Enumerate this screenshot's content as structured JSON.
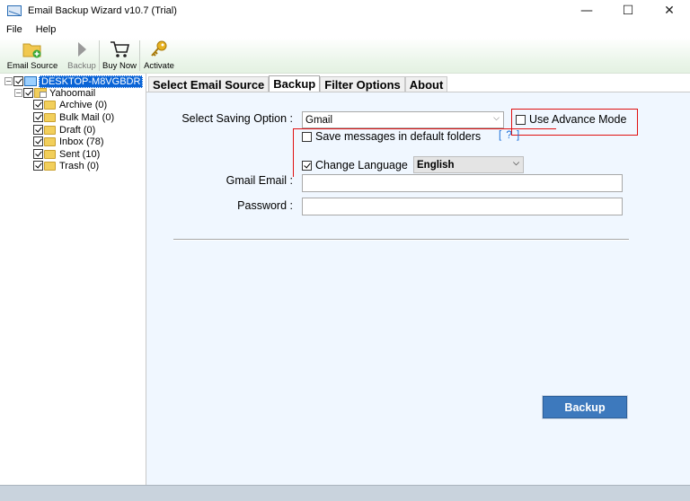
{
  "window": {
    "title": "Email Backup Wizard v10.7 (Trial)",
    "controls": {
      "minimize": "—",
      "maximize": "☐",
      "close": "✕"
    }
  },
  "menu": {
    "items": [
      "File",
      "Help"
    ]
  },
  "toolbar": {
    "email_source": "Email Source",
    "backup": "Backup",
    "buy_now": "Buy Now",
    "activate": "Activate"
  },
  "tree": {
    "root": "DESKTOP-M8VGBDR",
    "account": "Yahoomail",
    "folders": [
      "Archive (0)",
      "Bulk Mail (0)",
      "Draft (0)",
      "Inbox (78)",
      "Sent (10)",
      "Trash (0)"
    ]
  },
  "tabs": [
    "Select Email Source",
    "Backup",
    "Filter Options",
    "About"
  ],
  "backup": {
    "saving_option_label": "Select Saving Option :",
    "saving_option_value": "Gmail",
    "advance_mode_label": "Use Advance Mode",
    "save_default_label": "Save messages in default folders",
    "help_link": "[ ? ]",
    "change_language_label": "Change Language",
    "language_value": "English",
    "gmail_email_label": "Gmail Email :",
    "gmail_email_value": "",
    "password_label": "Password :",
    "password_value": "",
    "backup_button": "Backup"
  },
  "colors": {
    "accent_button": "#3d79bd",
    "highlight_box": "#e01010",
    "tree_selection": "#0a64d6",
    "content_bg": "#f0f7ff"
  }
}
